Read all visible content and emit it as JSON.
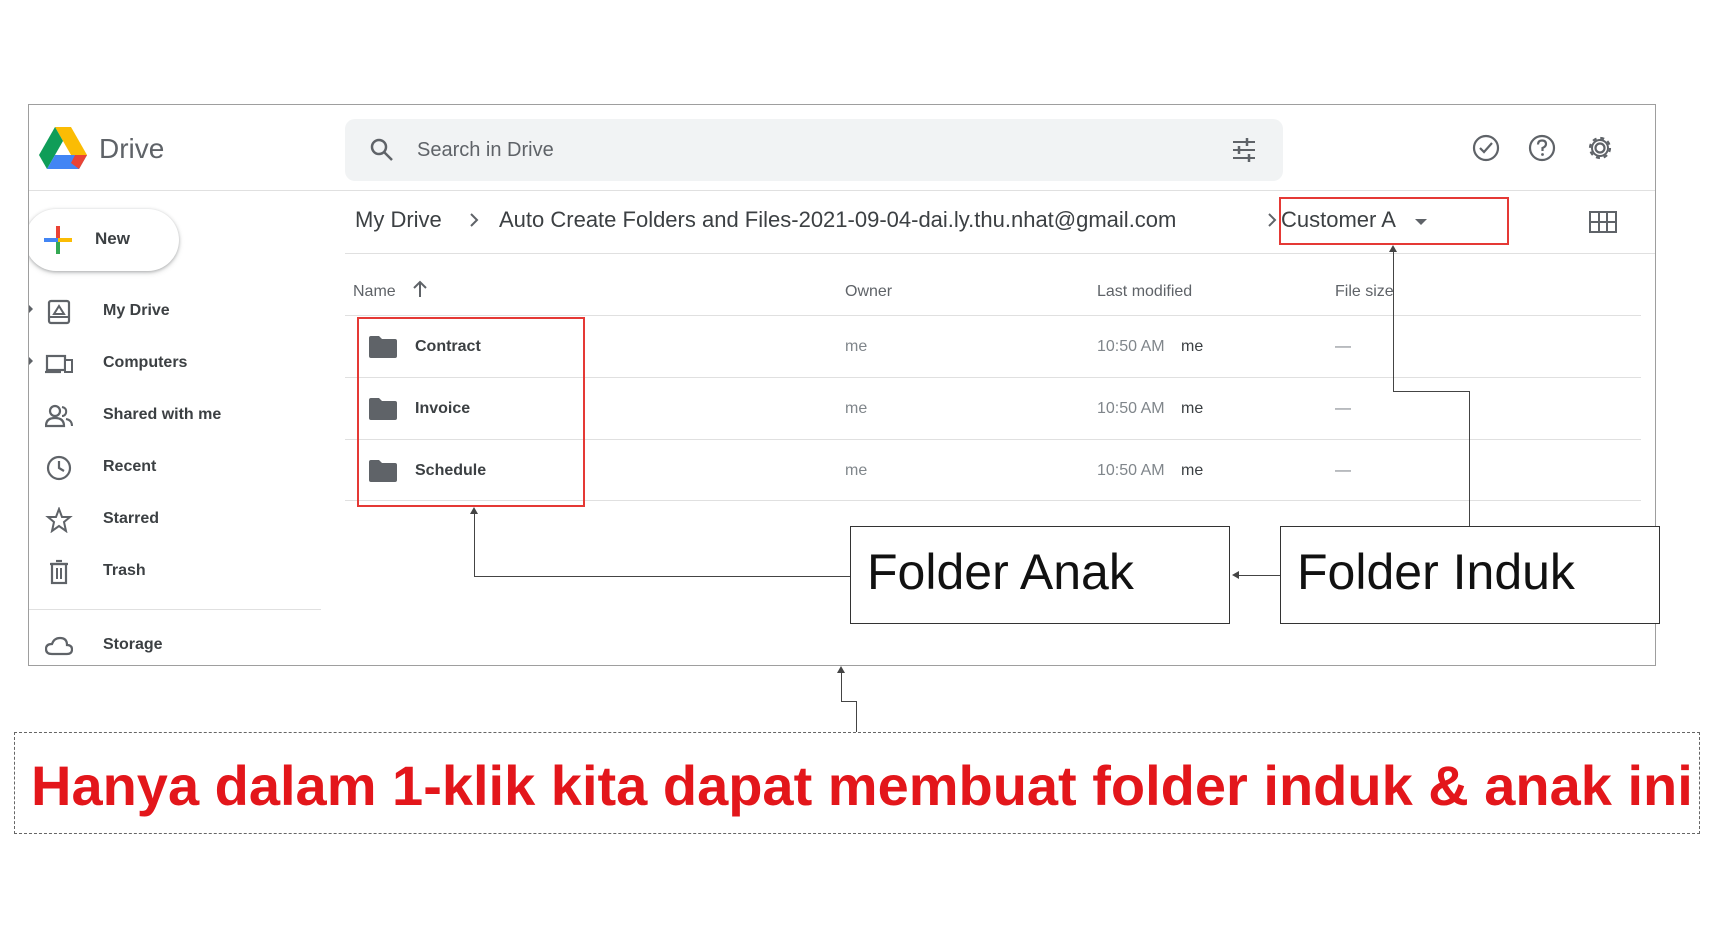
{
  "app": {
    "name": "Drive"
  },
  "search": {
    "placeholder": "Search in Drive"
  },
  "sidebar": {
    "new_label": "New",
    "items": [
      {
        "label": "My Drive",
        "icon": "my-drive-icon"
      },
      {
        "label": "Computers",
        "icon": "computers-icon"
      },
      {
        "label": "Shared with me",
        "icon": "shared-with-me-icon"
      },
      {
        "label": "Recent",
        "icon": "clock-icon"
      },
      {
        "label": "Starred",
        "icon": "star-icon"
      },
      {
        "label": "Trash",
        "icon": "trash-icon"
      },
      {
        "label": "Storage",
        "icon": "cloud-icon"
      }
    ]
  },
  "breadcrumb": {
    "items": [
      "My Drive",
      "Auto Create Folders and Files-2021-09-04-dai.ly.thu.nhat@gmail.com"
    ],
    "current": "Customer A"
  },
  "table": {
    "columns": {
      "name": "Name",
      "owner": "Owner",
      "modified": "Last modified",
      "size": "File size"
    },
    "rows": [
      {
        "name": "Contract",
        "owner": "me",
        "modified": "10:50 AM",
        "modified_by": "me",
        "size": "—"
      },
      {
        "name": "Invoice",
        "owner": "me",
        "modified": "10:50 AM",
        "modified_by": "me",
        "size": "—"
      },
      {
        "name": "Schedule",
        "owner": "me",
        "modified": "10:50 AM",
        "modified_by": "me",
        "size": "—"
      }
    ]
  },
  "annotations": {
    "child_folder": "Folder Anak",
    "parent_folder": "Folder Induk",
    "caption": "Hanya dalam 1-klik kita dapat membuat folder induk & anak ini"
  },
  "colors": {
    "highlight": "#e53935",
    "caption": "#e3161b"
  }
}
